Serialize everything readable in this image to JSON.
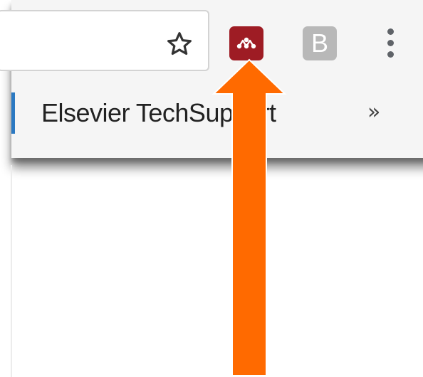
{
  "toolbar": {
    "bookmark_star_icon": "star-outline-icon",
    "extensions": [
      {
        "name": "mendeley-extension",
        "icon": "mendeley-logo-icon",
        "color": "#9e1c24"
      },
      {
        "name": "b-extension",
        "label": "B",
        "color": "#b8b8b8"
      }
    ],
    "menu_icon": "vertical-ellipsis-icon"
  },
  "bookmarks_bar": {
    "items": [
      {
        "label": "Elsevier TechSupport",
        "accent_color": "#2b79c2"
      }
    ],
    "overflow_label": "»"
  },
  "annotation": {
    "arrow_color": "#ff6a00",
    "arrow_icon": "arrow-up-icon"
  }
}
